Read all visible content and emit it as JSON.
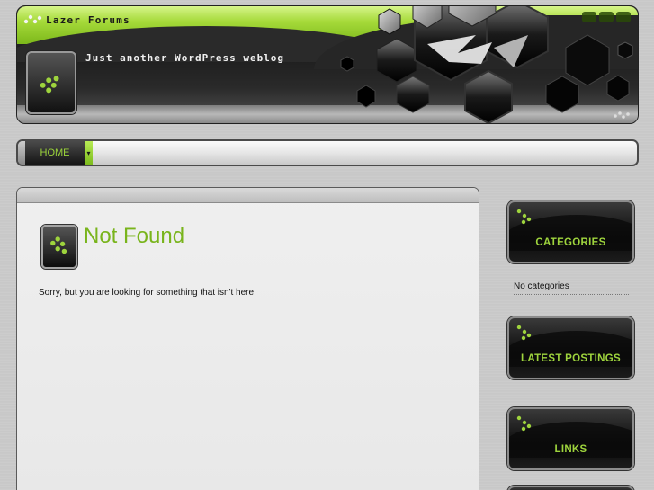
{
  "header": {
    "site_title": "Lazer Forums",
    "site_description": "Just another WordPress weblog",
    "icons": [
      "search-icon",
      "rss-icon",
      "equalizer-icon"
    ]
  },
  "nav": {
    "items": [
      {
        "label": "HOME"
      }
    ],
    "dropdown_glyph": "▾"
  },
  "main": {
    "title": "Not Found",
    "message": "Sorry, but you are looking for something that isn't here."
  },
  "sidebar": {
    "widgets": [
      {
        "title": "CATEGORIES",
        "body": "No categories"
      },
      {
        "title": "LATEST POSTINGS"
      },
      {
        "title": "LINKS"
      }
    ]
  },
  "colors": {
    "accent_green": "#79b41c",
    "widget_title_green": "#9ed43d",
    "dark": "#111111"
  }
}
